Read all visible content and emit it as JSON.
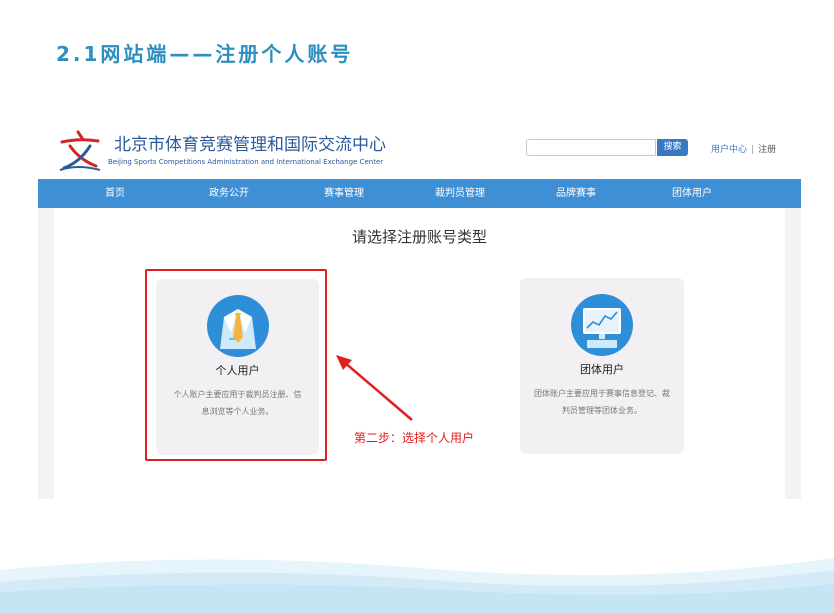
{
  "slide": {
    "title": "2.1网站端——注册个人账号"
  },
  "header": {
    "site_title": "北京市体育竞赛管理和国际交流中心",
    "site_subtitle": "Beijing Sports Competitions Administration and International Exchange Center",
    "search_placeholder": "",
    "search_button": "搜索",
    "user_center": "用户中心",
    "separator": "|",
    "register": "注册"
  },
  "nav": {
    "items": [
      "首页",
      "政务公开",
      "赛事管理",
      "裁判员管理",
      "品牌赛事",
      "团体用户"
    ]
  },
  "main": {
    "title": "请选择注册账号类型",
    "cards": [
      {
        "label": "个人用户",
        "desc": "个人账户主要应用于裁判员注册、信息浏览等个人业务。",
        "icon": "person-suit-icon"
      },
      {
        "label": "团体用户",
        "desc": "团体账户主要应用于赛事信息登记、裁判员管理等团体业务。",
        "icon": "monitor-chart-icon"
      }
    ]
  },
  "annotation": {
    "text": "第二步：选择个人用户"
  },
  "colors": {
    "nav_bg": "#3e8fd3",
    "accent": "#2c8fbf",
    "highlight": "#e02020"
  }
}
